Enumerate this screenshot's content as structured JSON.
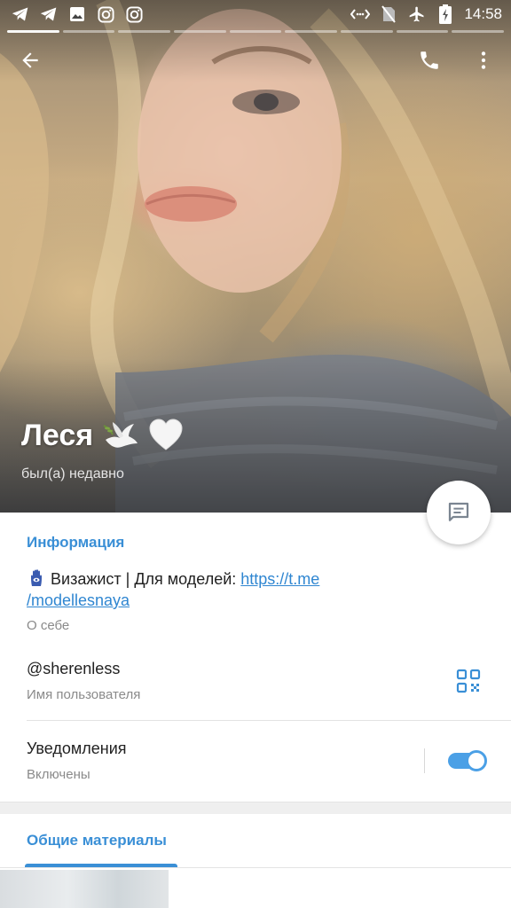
{
  "status_bar": {
    "time": "14:58",
    "left_icons": [
      "telegram-icon",
      "telegram-icon",
      "image-icon",
      "instagram-icon",
      "instagram-icon"
    ],
    "right_icons": [
      "data-saver-icon",
      "no-sim-icon",
      "airplane-icon",
      "battery-charging-icon"
    ]
  },
  "story": {
    "segments": 9,
    "active_index": 0
  },
  "toolbar": {
    "back_icon": "arrow-left-icon",
    "call_icon": "phone-icon",
    "menu_icon": "more-vert-icon"
  },
  "profile": {
    "name": "Леся",
    "name_emojis": [
      "dove-emoji",
      "white-heart-emoji"
    ],
    "last_seen": "был(а) недавно"
  },
  "info": {
    "section_title": "Информация",
    "bio_emoji": "hamsa-emoji",
    "bio_text": "Визажист | Для моделей: ",
    "bio_link_line1": "https://t.me",
    "bio_link_line2": "/modellesnaya",
    "bio_label": "О себе",
    "username": "@sherenless",
    "username_label": "Имя пользователя",
    "notifications_title": "Уведомления",
    "notifications_status": "Включены",
    "notifications_on": true
  },
  "shared": {
    "tab_label": "Общие материалы"
  },
  "colors": {
    "accent": "#3a8fd6",
    "link": "#2f86d1",
    "toggle": "#4ba0e6"
  }
}
